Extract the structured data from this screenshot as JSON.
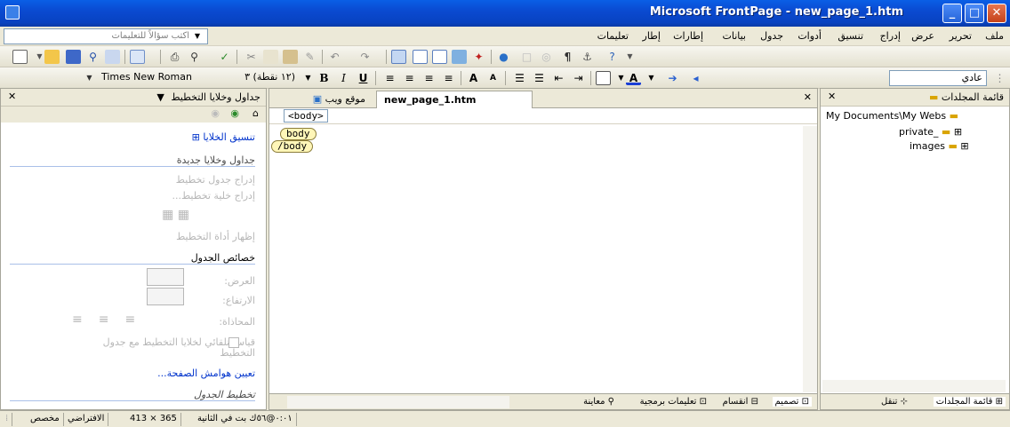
{
  "titlebar": {
    "title": "Microsoft FrontPage - new_page_1.htm",
    "min": "_",
    "max": "□",
    "close": "✕"
  },
  "menubar": {
    "items": [
      "ملف",
      "تحرير",
      "عرض",
      "إدراج",
      "تنسيق",
      "أدوات",
      "جدول",
      "بيانات",
      "إطارات",
      "إطار",
      "تعليمات"
    ],
    "ask_placeholder": "اكتب سؤالاً للتعليمات"
  },
  "format_toolbar": {
    "style_value": "عادي",
    "font_value": "Times New Roman",
    "size_value": "(١٢ نقطة) ٣"
  },
  "task_pane": {
    "title": "جداول وخلايا التخطيط",
    "cell_format_link": "تنسيق الخلايا",
    "new_tables_header": "جداول وخلايا جديدة",
    "insert_table": "إدراج جدول تخطيط",
    "insert_cell": "إدراج خلية تخطيط...",
    "show_tool": "إظهار أداة التخطيط",
    "table_props_header": "خصائص الجدول",
    "width_label": "العرض:",
    "height_label": "الارتفاع:",
    "align_label": "المحاذاة:",
    "autoscale_label": "قياس تلقائي لخلايا التخطيط مع جدول التخطيط",
    "margins_link": "تعيين هوامش الصفحة...",
    "table_layout_header": "تخطيط الجدول"
  },
  "editor": {
    "tabs": [
      "new_page_1.htm",
      "موقع ويب"
    ],
    "quick_tag": "<body>",
    "tag_open": "body",
    "tag_close": "/body",
    "view_tabs": [
      "تصميم",
      "انقسام",
      "تعليمات برمجية",
      "معاينة"
    ]
  },
  "folder_pane": {
    "title": "قائمة المجلدات",
    "root": "My Documents\\My Webs",
    "folders": [
      "private_",
      "images"
    ],
    "bottom_tabs": [
      "قائمة المجلدات",
      "تنقل"
    ]
  },
  "statusbar": {
    "download": "٠:٠١@٥٦ك بت في الثانية",
    "size": "413 × 365",
    "mode": "الافتراضي",
    "custom": "مخصص"
  },
  "colors": {
    "title_blue": "#0a4ad1",
    "tag_fill": "#fff6b8",
    "link": "#0033cc"
  }
}
